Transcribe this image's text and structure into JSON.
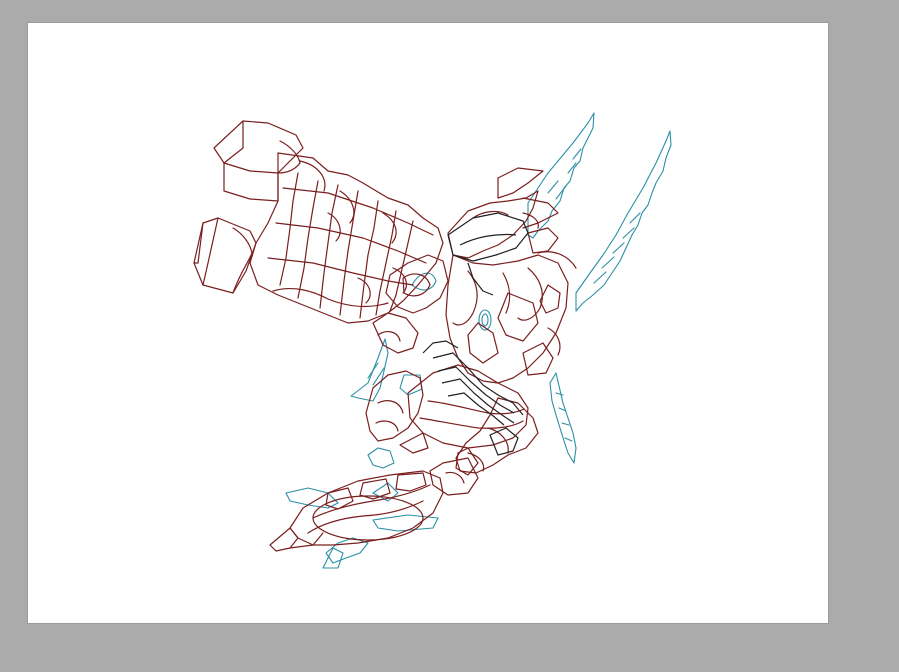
{
  "app": {
    "workspace_background": "#ababab",
    "canvas_background": "#ffffff"
  },
  "artwork": {
    "subject": "robot-mecha-line-art",
    "layers": [
      {
        "name": "outline-red",
        "color": "#7a1e1e"
      },
      {
        "name": "outline-teal",
        "color": "#2a8fa6"
      },
      {
        "name": "outline-dark",
        "color": "#222222"
      }
    ]
  }
}
